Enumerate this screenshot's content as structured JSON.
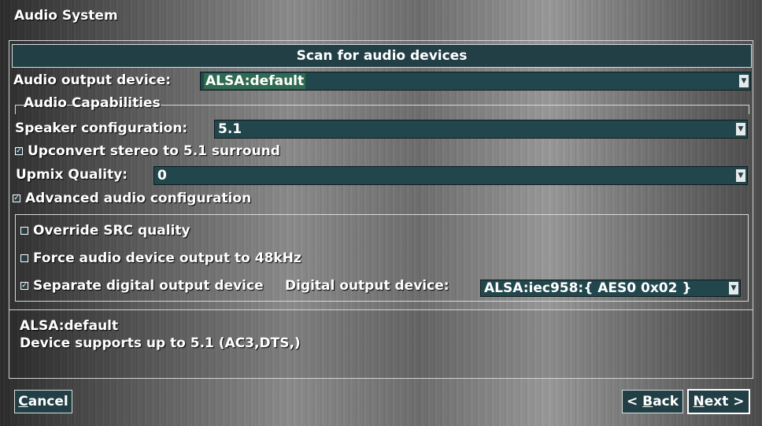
{
  "window": {
    "title": "Audio System"
  },
  "scan_button": {
    "label": "Scan for audio devices"
  },
  "audio_output": {
    "label": "Audio output device:",
    "value": "ALSA:default"
  },
  "capabilities": {
    "group_title": "Audio Capabilities",
    "speaker_label": "Speaker configuration:",
    "speaker_value": "5.1",
    "upconvert_label": "Upconvert stereo to 5.1 surround",
    "upconvert_checked": true,
    "upmix_label": "Upmix Quality:",
    "upmix_value": "0"
  },
  "advanced": {
    "label": "Advanced audio configuration",
    "checked": true,
    "override_src_label": "Override SRC quality",
    "override_src_checked": false,
    "force_48k_label": "Force audio device output to 48kHz",
    "force_48k_checked": false,
    "separate_digital_label": "Separate digital output device",
    "separate_digital_checked": true,
    "digital_output_label": "Digital output device:",
    "digital_output_value": "ALSA:iec958:{ AES0 0x02 }"
  },
  "help": {
    "line1": "ALSA:default",
    "line2": "Device supports up to 5.1 (AC3,DTS,)"
  },
  "buttons": {
    "cancel_u": "C",
    "cancel_rest": "ancel",
    "back_pre": "< ",
    "back_u": "B",
    "back_rest": "ack",
    "next_u": "N",
    "next_rest": "ext >"
  },
  "icons": {
    "dropdown": "chevron-down-icon",
    "check": "checkmark-icon"
  }
}
